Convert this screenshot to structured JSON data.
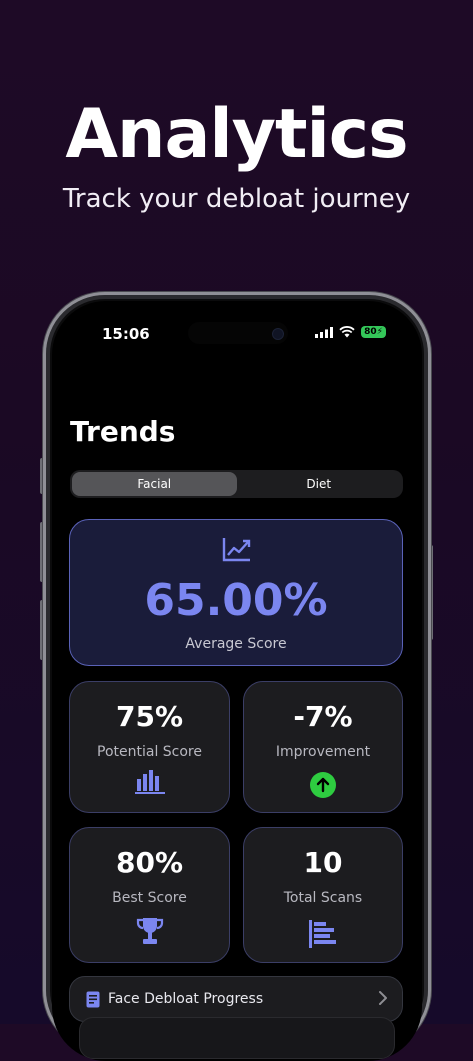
{
  "hero": {
    "title": "Analytics",
    "subtitle": "Track your debloat journey"
  },
  "status_bar": {
    "time": "15:06",
    "battery": "80"
  },
  "screen": {
    "title": "Trends",
    "tabs": [
      {
        "label": "Facial",
        "active": true
      },
      {
        "label": "Diet",
        "active": false
      }
    ],
    "average": {
      "value": "65.00%",
      "label": "Average Score",
      "icon": "trend-chart-icon"
    },
    "stats": [
      {
        "value": "75%",
        "label": "Potential Score",
        "icon": "bar-chart-icon"
      },
      {
        "value": "-7%",
        "label": "Improvement",
        "icon": "arrow-up-circle-icon"
      },
      {
        "value": "80%",
        "label": "Best Score",
        "icon": "trophy-icon"
      },
      {
        "value": "10",
        "label": "Total Scans",
        "icon": "horizontal-bars-icon"
      }
    ],
    "progress_link": {
      "label": "Face Debloat Progress",
      "icon": "document-icon"
    }
  },
  "colors": {
    "accent": "#7b86f0",
    "success": "#2ecc40",
    "battery": "#34c759"
  }
}
